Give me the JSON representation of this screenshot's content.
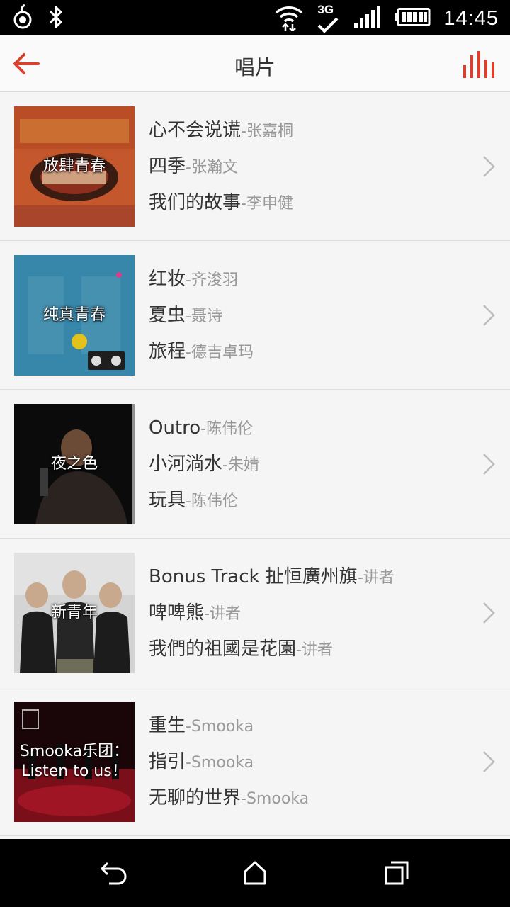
{
  "status_bar": {
    "left_icons": [
      "notification-icon",
      "bluetooth-icon"
    ],
    "right_icons": [
      "wifi-icon",
      "3g-icon",
      "signal-icon",
      "battery-icon"
    ],
    "network_label": "3G",
    "time": "14:45"
  },
  "app_bar": {
    "back_icon": "arrow-left-icon",
    "title": "唱片",
    "action_icon": "equalizer-icon",
    "accent_color": "#d9412e"
  },
  "separator": "-",
  "albums": [
    {
      "title": "放肆青春",
      "songs": [
        {
          "name": "心不会说谎",
          "artist": "张嘉桐"
        },
        {
          "name": "四季",
          "artist": "张瀚文"
        },
        {
          "name": "我们的故事",
          "artist": "李申健"
        }
      ]
    },
    {
      "title": "纯真青春",
      "songs": [
        {
          "name": "红妆",
          "artist": "齐浚羽"
        },
        {
          "name": "夏虫",
          "artist": "聂诗"
        },
        {
          "name": "旅程",
          "artist": "德吉卓玛"
        }
      ]
    },
    {
      "title": "夜之色",
      "songs": [
        {
          "name": "Outro",
          "artist": "陈伟伦"
        },
        {
          "name": "小河淌水",
          "artist": "朱婧"
        },
        {
          "name": "玩具",
          "artist": "陈伟伦"
        }
      ]
    },
    {
      "title": "新青年",
      "songs": [
        {
          "name": "Bonus Track 扯恒廣州旗",
          "artist": "讲者"
        },
        {
          "name": "啤啤熊",
          "artist": "讲者"
        },
        {
          "name": "我們的祖國是花園",
          "artist": "讲者"
        }
      ]
    },
    {
      "title": "Smooka乐团：Listen to us！",
      "songs": [
        {
          "name": "重生",
          "artist": "Smooka"
        },
        {
          "name": "指引",
          "artist": "Smooka"
        },
        {
          "name": "无聊的世界",
          "artist": "Smooka"
        }
      ]
    }
  ],
  "nav_bar": {
    "icons": [
      "back-icon",
      "home-icon",
      "recents-icon"
    ]
  }
}
